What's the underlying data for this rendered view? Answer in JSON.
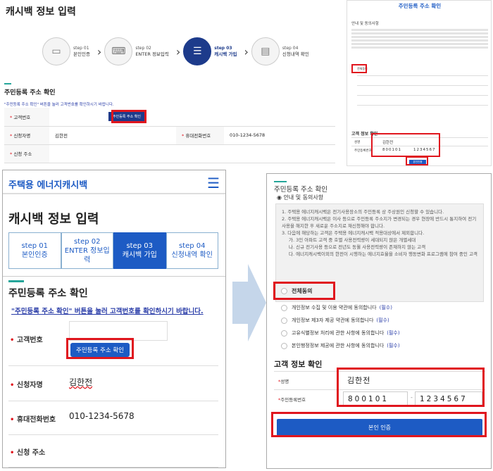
{
  "desktop": {
    "page_title": "캐시백 정보 입력",
    "steps": [
      {
        "num": "step 01",
        "label": "본인인증"
      },
      {
        "num": "step 02",
        "label": "ENTER 정보입력"
      },
      {
        "num": "step 03",
        "label": "캐시백 가입"
      },
      {
        "num": "step 04",
        "label": "신청내역 확인"
      }
    ],
    "section_title": "주민등록 주소 확인",
    "notice": "\"주민등록 주소 확인\" 버튼을 눌러 고객번호를 확인하시기 바랍니다.",
    "rows": {
      "customer_no_label": "고객번호",
      "check_button": "주민등록 주소 확인",
      "applicant_label": "신청자명",
      "applicant_value": "김한전",
      "phone_label": "휴대전화번호",
      "phone_value": "010-1234-5678",
      "address_label": "신청 주소"
    }
  },
  "mobile": {
    "logo": "주택용 에너지캐시백",
    "page_title": "캐시백 정보 입력",
    "steps": [
      {
        "num": "step 01",
        "label": "본인인증"
      },
      {
        "num": "step 02",
        "label": "ENTER 정보입력"
      },
      {
        "num": "step 03",
        "label": "캐시백 가입"
      },
      {
        "num": "step 04",
        "label": "신청내역 확인"
      }
    ],
    "section_title": "주민등록 주소 확인",
    "notice": "\"주민등록 주소 확인\" 버튼을 눌러 고객번호를 확인하시기 바랍니다.",
    "customer_no_label": "고객번호",
    "check_button": "주민등록 주소 확인",
    "applicant_label": "신청자명",
    "applicant_value": "김한전",
    "phone_label": "휴대전화번호",
    "phone_value": "010-1234-5678",
    "address_label": "신청 주소"
  },
  "modal_large": {
    "title": "주민등록 주소 확인",
    "subhead": "안내 및 동의사항",
    "notice_lines": [
      "1. 주택용 에너지캐시백은 전기사용장소의 주민등록 상 주상원인 신청할 수 있습니다.",
      "2. 주택용 에너지캐시백은 이사 등으로 주민등록 주소지가 변경되는 경우 현장에 반드시 통지하여 전기 사용을 해지한 후 새로운 주소지로 재신청해야 합니다.",
      "3. 다음에 해당하는 고객은 주택용 에너지캐시백 적용대상에서 제외합니다.",
      "가. 3인 아파트 고객 중 호별 사용전력량이 세대되지 않은 개별세대",
      "나. 신규 전기사용 등으로 전년도 동월 사용전력량이 존재하지 않는 고객",
      "다. 에너지캐시백이외의 한전이 시행하는 에너지효율을 소비자 행동변화 프로그램에 참여 중인 고객"
    ],
    "agree_all": "전체동의",
    "agreements": [
      "개인정보 수집 및 이용 약관에 동의합니다",
      "개인정보 제3자 제공 약관에 동의합니다",
      "고유식별정보 처리에 관한 사항에 동의합니다",
      "본인행정정보 제공에 관한 사항에 동의합니다"
    ],
    "required_tag": "(필수)",
    "customer_info_title": "고객 정보 확인",
    "name_label": "성명",
    "name_value": "김한전",
    "rrn_label": "주민등록번호",
    "rrn_front": "800101",
    "rrn_back": "1234567",
    "cta": "본인 인증"
  },
  "modal_small": {
    "title": "주민등록 주소 확인",
    "subhead": "안내 및 동의사항",
    "agree_all": "전체동의",
    "customer_info_title": "고객 정보 확인",
    "name_label": "성명",
    "name_value": "김한전",
    "rrn_label": "주민등록번호",
    "rrn_front": "800101",
    "rrn_back": "1234567",
    "cta": "본인인증"
  },
  "colors": {
    "accent": "#1d5bc4",
    "navy": "#1d3b8b",
    "highlight": "#e0161e",
    "arrow": "#c5d6ea"
  }
}
